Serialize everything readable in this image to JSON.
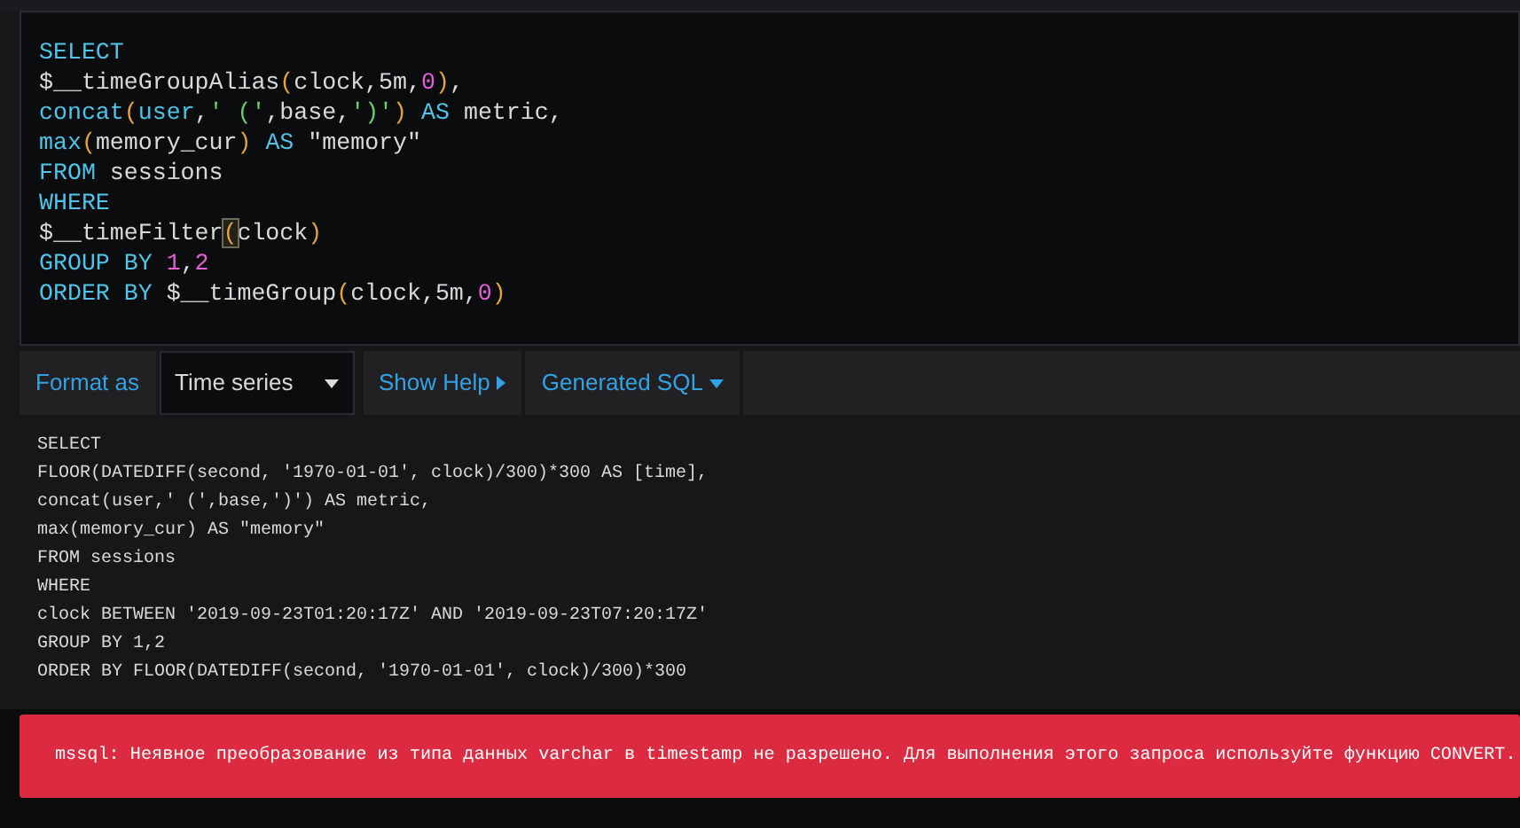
{
  "query_editor": {
    "lines": [
      [
        {
          "text": "SELECT",
          "kind": "keyword"
        }
      ],
      [
        {
          "text": "$__timeGroupAlias",
          "kind": "plain"
        },
        {
          "text": "(",
          "kind": "paren"
        },
        {
          "text": "clock,5m,",
          "kind": "plain"
        },
        {
          "text": "0",
          "kind": "number"
        },
        {
          "text": ")",
          "kind": "paren"
        },
        {
          "text": ",",
          "kind": "plain"
        }
      ],
      [
        {
          "text": "concat",
          "kind": "keyword"
        },
        {
          "text": "(",
          "kind": "paren"
        },
        {
          "text": "user",
          "kind": "keyword"
        },
        {
          "text": ",",
          "kind": "plain"
        },
        {
          "text": "' ('",
          "kind": "string"
        },
        {
          "text": ",base,",
          "kind": "plain"
        },
        {
          "text": "')'",
          "kind": "string"
        },
        {
          "text": ")",
          "kind": "paren"
        },
        {
          "text": " AS",
          "kind": "keyword"
        },
        {
          "text": " metric,",
          "kind": "plain"
        }
      ],
      [
        {
          "text": "max",
          "kind": "keyword"
        },
        {
          "text": "(",
          "kind": "paren"
        },
        {
          "text": "memory_cur",
          "kind": "plain"
        },
        {
          "text": ")",
          "kind": "paren"
        },
        {
          "text": " AS",
          "kind": "keyword"
        },
        {
          "text": " \"memory\"",
          "kind": "plain"
        }
      ],
      [
        {
          "text": "FROM",
          "kind": "keyword"
        },
        {
          "text": " sessions",
          "kind": "plain"
        }
      ],
      [
        {
          "text": "WHERE",
          "kind": "keyword"
        }
      ],
      [
        {
          "text": "$__timeFilter",
          "kind": "plain"
        },
        {
          "text": "(",
          "kind": "matched_paren"
        },
        {
          "text": "clock",
          "kind": "plain"
        },
        {
          "text": ")",
          "kind": "paren"
        }
      ],
      [
        {
          "text": "GROUP BY ",
          "kind": "keyword"
        },
        {
          "text": "1",
          "kind": "number"
        },
        {
          "text": ",",
          "kind": "plain"
        },
        {
          "text": "2",
          "kind": "number"
        }
      ],
      [
        {
          "text": "ORDER BY",
          "kind": "keyword"
        },
        {
          "text": " $__timeGroup",
          "kind": "plain"
        },
        {
          "text": "(",
          "kind": "paren"
        },
        {
          "text": "clock,5m,",
          "kind": "plain"
        },
        {
          "text": "0",
          "kind": "number"
        },
        {
          "text": ")",
          "kind": "paren"
        }
      ]
    ]
  },
  "toolbar": {
    "format_label": "Format as",
    "format_select": "Time series",
    "show_help": {
      "label": "Show Help",
      "expanded": false
    },
    "generated_sql": {
      "label": "Generated SQL",
      "expanded": true
    }
  },
  "generated_sql": [
    "SELECT",
    "FLOOR(DATEDIFF(second, '1970-01-01', clock)/300)*300 AS [time],",
    "concat(user,' (',base,')') AS metric,",
    "max(memory_cur) AS \"memory\"",
    "FROM sessions",
    "WHERE",
    "clock BETWEEN '2019-09-23T01:20:17Z' AND '2019-09-23T07:20:17Z'",
    "GROUP BY 1,2",
    "ORDER BY FLOOR(DATEDIFF(second, '1970-01-01', clock)/300)*300"
  ],
  "error": "mssql: Неявное преобразование из типа данных varchar в timestamp не разрешено. Для выполнения этого запроса используйте функцию CONVERT."
}
